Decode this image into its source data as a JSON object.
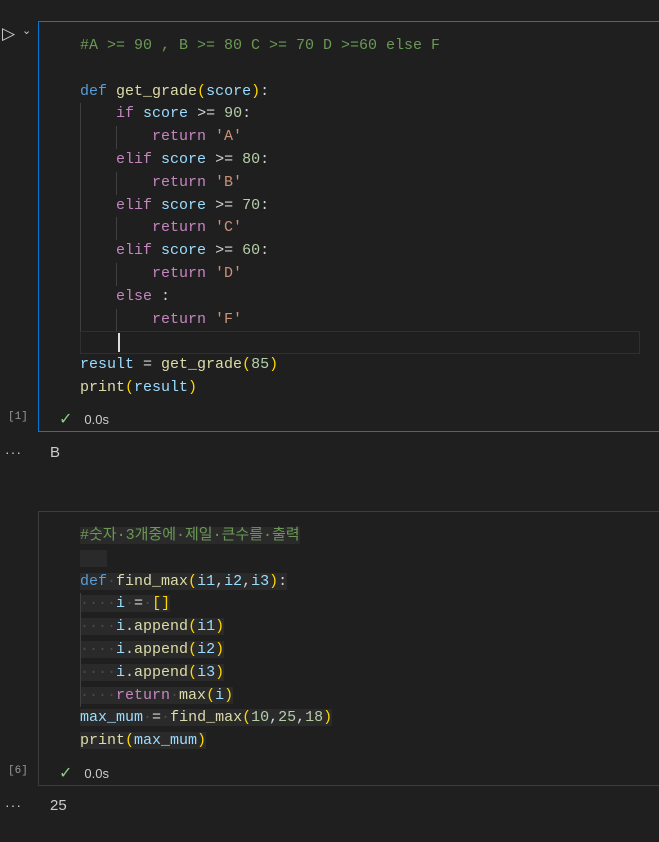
{
  "cells": [
    {
      "exec_count": "[1]",
      "status_time": "0.0s",
      "output": "B",
      "lines": [
        [
          [
            "c",
            "#A >= 90 , B >= 80 C >= 70 D >=60 else F"
          ]
        ],
        [],
        [
          [
            "kw",
            "def"
          ],
          [
            "o",
            " "
          ],
          [
            "fn",
            "get_grade"
          ],
          [
            "p",
            "("
          ],
          [
            "v",
            "score"
          ],
          [
            "p",
            ")"
          ],
          [
            "o",
            ":"
          ]
        ],
        [
          [
            "o",
            "    "
          ],
          [
            "ctl",
            "if"
          ],
          [
            "o",
            " "
          ],
          [
            "v",
            "score"
          ],
          [
            "o",
            " >= "
          ],
          [
            "n",
            "90"
          ],
          [
            "o",
            ":"
          ]
        ],
        [
          [
            "o",
            "        "
          ],
          [
            "ctl",
            "return"
          ],
          [
            "o",
            " "
          ],
          [
            "s",
            "'A'"
          ]
        ],
        [
          [
            "o",
            "    "
          ],
          [
            "ctl",
            "elif"
          ],
          [
            "o",
            " "
          ],
          [
            "v",
            "score"
          ],
          [
            "o",
            " >= "
          ],
          [
            "n",
            "80"
          ],
          [
            "o",
            ":"
          ]
        ],
        [
          [
            "o",
            "        "
          ],
          [
            "ctl",
            "return"
          ],
          [
            "o",
            " "
          ],
          [
            "s",
            "'B'"
          ]
        ],
        [
          [
            "o",
            "    "
          ],
          [
            "ctl",
            "elif"
          ],
          [
            "o",
            " "
          ],
          [
            "v",
            "score"
          ],
          [
            "o",
            " >= "
          ],
          [
            "n",
            "70"
          ],
          [
            "o",
            ":"
          ]
        ],
        [
          [
            "o",
            "        "
          ],
          [
            "ctl",
            "return"
          ],
          [
            "o",
            " "
          ],
          [
            "s",
            "'C'"
          ]
        ],
        [
          [
            "o",
            "    "
          ],
          [
            "ctl",
            "elif"
          ],
          [
            "o",
            " "
          ],
          [
            "v",
            "score"
          ],
          [
            "o",
            " >= "
          ],
          [
            "n",
            "60"
          ],
          [
            "o",
            ":"
          ]
        ],
        [
          [
            "o",
            "        "
          ],
          [
            "ctl",
            "return"
          ],
          [
            "o",
            " "
          ],
          [
            "s",
            "'D'"
          ]
        ],
        [
          [
            "o",
            "    "
          ],
          [
            "ctl",
            "else"
          ],
          [
            "o",
            " :"
          ]
        ],
        [
          [
            "o",
            "        "
          ],
          [
            "ctl",
            "return"
          ],
          [
            "o",
            " "
          ],
          [
            "s",
            "'F'"
          ]
        ],
        [],
        [
          [
            "v",
            "result"
          ],
          [
            "o",
            " = "
          ],
          [
            "fn",
            "get_grade"
          ],
          [
            "p",
            "("
          ],
          [
            "n",
            "85"
          ],
          [
            "p",
            ")"
          ]
        ],
        [
          [
            "fn",
            "print"
          ],
          [
            "p",
            "("
          ],
          [
            "v",
            "result"
          ],
          [
            "p",
            ")"
          ]
        ]
      ]
    },
    {
      "exec_count": "[6]",
      "status_time": "0.0s",
      "output": "25",
      "lines": [
        [
          [
            "c",
            "#숫자·3개중에·제일·큰수를·출력"
          ]
        ],
        [
          [
            "ws",
            "   "
          ]
        ],
        [
          [
            "kw",
            "def"
          ],
          [
            "ws",
            "·"
          ],
          [
            "fn",
            "find_max"
          ],
          [
            "p",
            "("
          ],
          [
            "v",
            "i1"
          ],
          [
            "o",
            ","
          ],
          [
            "v",
            "i2"
          ],
          [
            "o",
            ","
          ],
          [
            "v",
            "i3"
          ],
          [
            "p",
            ")"
          ],
          [
            "o",
            ":"
          ]
        ],
        [
          [
            "ws",
            "····"
          ],
          [
            "v",
            "i"
          ],
          [
            "ws",
            "·"
          ],
          [
            "o",
            "="
          ],
          [
            "ws",
            "·"
          ],
          [
            "p",
            "[]"
          ]
        ],
        [
          [
            "ws",
            "····"
          ],
          [
            "v",
            "i"
          ],
          [
            "o",
            "."
          ],
          [
            "fn",
            "append"
          ],
          [
            "p",
            "("
          ],
          [
            "v",
            "i1"
          ],
          [
            "p",
            ")"
          ]
        ],
        [
          [
            "ws",
            "····"
          ],
          [
            "v",
            "i"
          ],
          [
            "o",
            "."
          ],
          [
            "fn",
            "append"
          ],
          [
            "p",
            "("
          ],
          [
            "v",
            "i2"
          ],
          [
            "p",
            ")"
          ]
        ],
        [
          [
            "ws",
            "····"
          ],
          [
            "v",
            "i"
          ],
          [
            "o",
            "."
          ],
          [
            "fn",
            "append"
          ],
          [
            "p",
            "("
          ],
          [
            "v",
            "i3"
          ],
          [
            "p",
            ")"
          ]
        ],
        [
          [
            "ws",
            "····"
          ],
          [
            "ctl",
            "return"
          ],
          [
            "ws",
            "·"
          ],
          [
            "fn",
            "max"
          ],
          [
            "p",
            "("
          ],
          [
            "v",
            "i"
          ],
          [
            "p",
            ")"
          ]
        ],
        [
          [
            "v",
            "max_mum"
          ],
          [
            "ws",
            "·"
          ],
          [
            "o",
            "="
          ],
          [
            "ws",
            "·"
          ],
          [
            "fn",
            "find_max"
          ],
          [
            "p",
            "("
          ],
          [
            "n",
            "10"
          ],
          [
            "o",
            ","
          ],
          [
            "n",
            "25"
          ],
          [
            "o",
            ","
          ],
          [
            "n",
            "18"
          ],
          [
            "p",
            ")"
          ]
        ],
        [
          [
            "fn",
            "print"
          ],
          [
            "p",
            "("
          ],
          [
            "v",
            "max_mum"
          ],
          [
            "p",
            ")"
          ]
        ]
      ]
    }
  ]
}
